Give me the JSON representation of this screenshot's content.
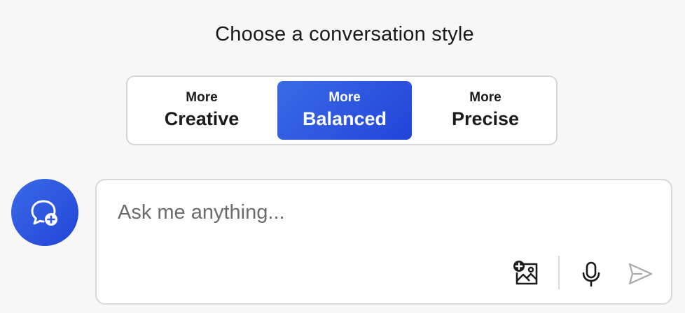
{
  "heading": "Choose a conversation style",
  "styles": [
    {
      "small": "More",
      "big": "Creative"
    },
    {
      "small": "More",
      "big": "Balanced"
    },
    {
      "small": "More",
      "big": "Precise"
    }
  ],
  "selected_style": "Balanced",
  "input": {
    "placeholder": "Ask me anything...",
    "value": ""
  },
  "colors": {
    "accent": "#2f55e0",
    "background": "#f7f7f7"
  },
  "icons": [
    "new-topic-icon",
    "add-image-icon",
    "microphone-icon",
    "send-icon"
  ]
}
